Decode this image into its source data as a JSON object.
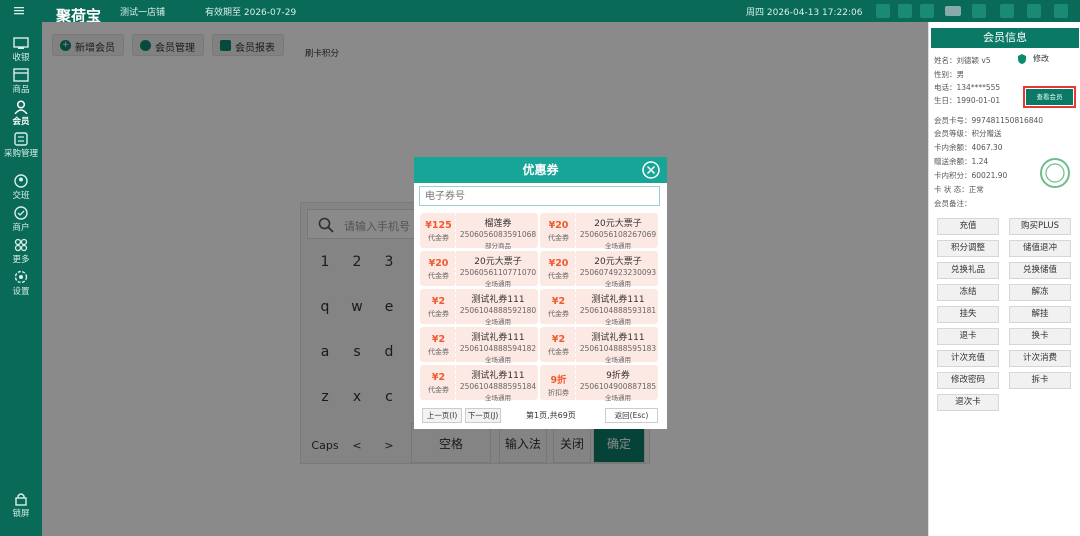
{
  "topbar": {
    "logo": "聚荷宝",
    "store": "测试一店铺",
    "expire": "有效期至 2026-07-29",
    "datetime": "周四 2026-04-13 17:22:06"
  },
  "sidebar": {
    "items": [
      {
        "label": "收银",
        "icon": "cashier-icon"
      },
      {
        "label": "商品",
        "icon": "goods-icon"
      },
      {
        "label": "会员",
        "icon": "member-icon"
      },
      {
        "label": "采购管理",
        "icon": "purchase-icon"
      },
      {
        "label": "交班",
        "icon": "shift-icon"
      },
      {
        "label": "商户",
        "icon": "merchant-icon"
      },
      {
        "label": "更多",
        "icon": "more-icon"
      },
      {
        "label": "设置",
        "icon": "settings-icon"
      }
    ],
    "footer": {
      "label": "锁屏",
      "icon": "lock-icon"
    }
  },
  "main": {
    "toolbar": [
      {
        "label": "新增会员",
        "icon": "plus-icon"
      },
      {
        "label": "会员管理",
        "icon": "member-icon"
      },
      {
        "label": "会员报表",
        "icon": "report-icon"
      }
    ],
    "hint": "刷卡积分",
    "keyboard": {
      "search_placeholder": "请输入手机号",
      "rows": [
        [
          "1",
          "2",
          "3"
        ],
        [
          "q",
          "w",
          "e"
        ],
        [
          "a",
          "s",
          "d"
        ],
        [
          "z",
          "x",
          "c"
        ]
      ],
      "bottom": [
        "Caps",
        "<",
        ">"
      ],
      "space": "空格",
      "ime": "输入法",
      "close": "关闭",
      "confirm": "确定"
    }
  },
  "member_panel": {
    "title": "会员信息",
    "edit": "修改",
    "name": "姓名：刘德颖 v5",
    "gender": "性别：男",
    "phone": "电话：134****555",
    "birthday": "生日：1990-01-01",
    "select_btn": "查看会员",
    "card_no": "会员卡号：997481150816840",
    "level": "会员等级：积分赠送",
    "balance": "卡内余额：4067.30",
    "credit": "赠送余额：1.24",
    "points": "卡内积分：60021.90",
    "status": "卡 状 态：正常",
    "remark": "会员备注：",
    "buttons": [
      "充值",
      "购买PLUS",
      "积分调整",
      "储值退冲",
      "兑换礼品",
      "兑换储值",
      "冻结",
      "解冻",
      "挂失",
      "解挂",
      "退卡",
      "换卡",
      "计次充值",
      "计次消费",
      "修改密码",
      "拆卡",
      "退次卡"
    ]
  },
  "dialog": {
    "title": "优惠券",
    "search_placeholder": "电子券号",
    "coupons": [
      {
        "value": "¥125",
        "type": "代金券",
        "name": "榴莲券",
        "code": "2506056083591068",
        "scope": "部分商品"
      },
      {
        "value": "¥20",
        "type": "代金券",
        "name": "20元大票子",
        "code": "2506056108267069",
        "scope": "全场通用"
      },
      {
        "value": "¥20",
        "type": "代金券",
        "name": "20元大票子",
        "code": "2506056110771070",
        "scope": "全场通用"
      },
      {
        "value": "¥20",
        "type": "代金券",
        "name": "20元大票子",
        "code": "2506074923230093",
        "scope": "全场通用"
      },
      {
        "value": "¥2",
        "type": "代金券",
        "name": "测试礼券111",
        "code": "2506104888592180",
        "scope": "全场通用"
      },
      {
        "value": "¥2",
        "type": "代金券",
        "name": "测试礼券111",
        "code": "2506104888593181",
        "scope": "全场通用"
      },
      {
        "value": "¥2",
        "type": "代金券",
        "name": "测试礼券111",
        "code": "2506104888594182",
        "scope": "全场通用"
      },
      {
        "value": "¥2",
        "type": "代金券",
        "name": "测试礼券111",
        "code": "2506104888595183",
        "scope": "全场通用"
      },
      {
        "value": "¥2",
        "type": "代金券",
        "name": "测试礼券111",
        "code": "2506104888595184",
        "scope": "全场通用"
      },
      {
        "value": "9折",
        "type": "折扣券",
        "name": "9折券",
        "code": "2506104900887185",
        "scope": "全场通用"
      }
    ],
    "prev": "上一页(I)",
    "next": "下一页(J)",
    "page_info": "第1页,共69页",
    "back": "返回(Esc)"
  },
  "colors": {
    "brand": "#0a6a58",
    "dialog_header": "#17a598",
    "coupon_bg": "#fde9e3",
    "coupon_value": "#ef5b2f",
    "highlight": "#e53935"
  }
}
